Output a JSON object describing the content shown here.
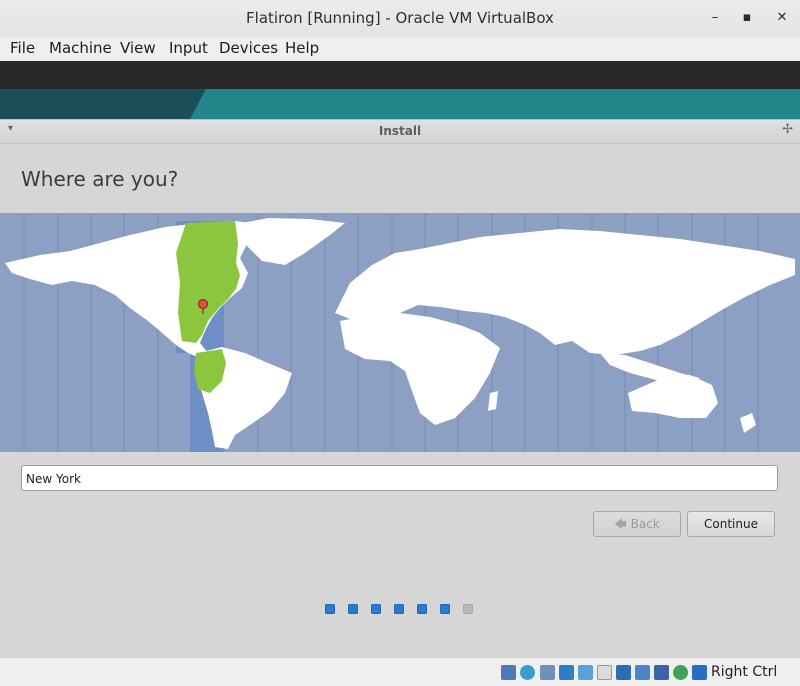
{
  "window": {
    "title": "Flatiron [Running] - Oracle VM VirtualBox",
    "minimize_glyph": "–",
    "maximize_glyph": "▪",
    "close_glyph": "✕"
  },
  "menubar": [
    "File",
    "Machine",
    "View",
    "Input",
    "Devices",
    "Help"
  ],
  "installer": {
    "title": "Install",
    "heading": "Where are you?",
    "location_value": "New York",
    "back_label": "Back",
    "continue_label": "Continue",
    "progress": {
      "total_steps": 7,
      "completed_steps": 6
    },
    "map": {
      "selected_city": "New York",
      "ocean_color": "#8ba0c3",
      "land_color": "#ffffff",
      "highlight_timezone_color": "#6d8fc6",
      "highlight_land_color": "#8cc63e",
      "marker_color": "#e84c3d"
    }
  },
  "statusbar": {
    "icons": [
      "hard-disk-icon",
      "optical-drive-icon",
      "audio-icon",
      "network-icon",
      "usb-icon",
      "shared-folders-icon",
      "display-icon",
      "video-capture-icon",
      "cpu-icon",
      "mouse-integration-icon",
      "keyboard-icon"
    ],
    "host_key": "Right Ctrl"
  },
  "colors": {
    "accent_progress": "#2a7ad6",
    "dialog_bg": "#d6d6d6"
  }
}
